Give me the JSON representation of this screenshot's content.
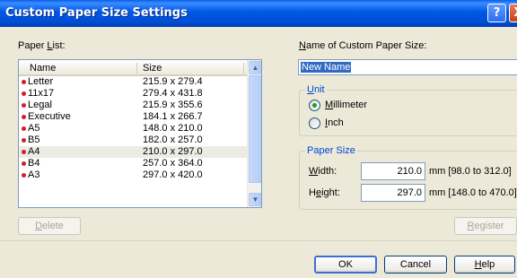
{
  "window": {
    "title": "Custom Paper Size Settings",
    "help_glyph": "?",
    "close_glyph": "X"
  },
  "paper_list": {
    "label_prefix": "Paper ",
    "label_mnemonic": "L",
    "label_suffix": "ist:",
    "columns": [
      "Name",
      "Size"
    ],
    "rows": [
      {
        "name": "Letter",
        "size": "215.9 x 279.4"
      },
      {
        "name": "11x17",
        "size": "279.4 x 431.8"
      },
      {
        "name": "Legal",
        "size": "215.9 x 355.6"
      },
      {
        "name": "Executive",
        "size": "184.1 x 266.7"
      },
      {
        "name": "A5",
        "size": "148.0 x 210.0"
      },
      {
        "name": "B5",
        "size": "182.0 x 257.0"
      },
      {
        "name": "A4",
        "size": "210.0 x 297.0"
      },
      {
        "name": "B4",
        "size": "257.0 x 364.0"
      },
      {
        "name": "A3",
        "size": "297.0 x 420.0"
      }
    ],
    "selected_row": "A4",
    "scroll_up_glyph": "▲",
    "scroll_down_glyph": "▼"
  },
  "delete_button": {
    "mnemonic": "D",
    "rest": "elete"
  },
  "custom_name": {
    "label_mnemonic": "N",
    "label_rest": "ame of Custom Paper Size:",
    "value": "New Name"
  },
  "unit": {
    "label_mnemonic": "U",
    "label_rest": "nit",
    "options": [
      {
        "mnemonic": "M",
        "rest": "illimeter",
        "selected": true
      },
      {
        "mnemonic": "I",
        "rest": "nch",
        "selected": false
      }
    ]
  },
  "paper_size": {
    "label": "Paper Size",
    "width": {
      "mnemonic": "W",
      "rest": "idth:",
      "value": "210.0",
      "range": "mm [98.0 to 312.0]"
    },
    "height": {
      "mnemonic": "e",
      "prefix": "H",
      "rest": "ight:",
      "value": "297.0",
      "range": "mm [148.0 to 470.0]"
    }
  },
  "register_button": {
    "mnemonic": "R",
    "rest": "egister"
  },
  "ok_button": {
    "label": "OK"
  },
  "cancel_button": {
    "label": "Cancel"
  },
  "help_button": {
    "mnemonic": "H",
    "rest": "elp"
  }
}
